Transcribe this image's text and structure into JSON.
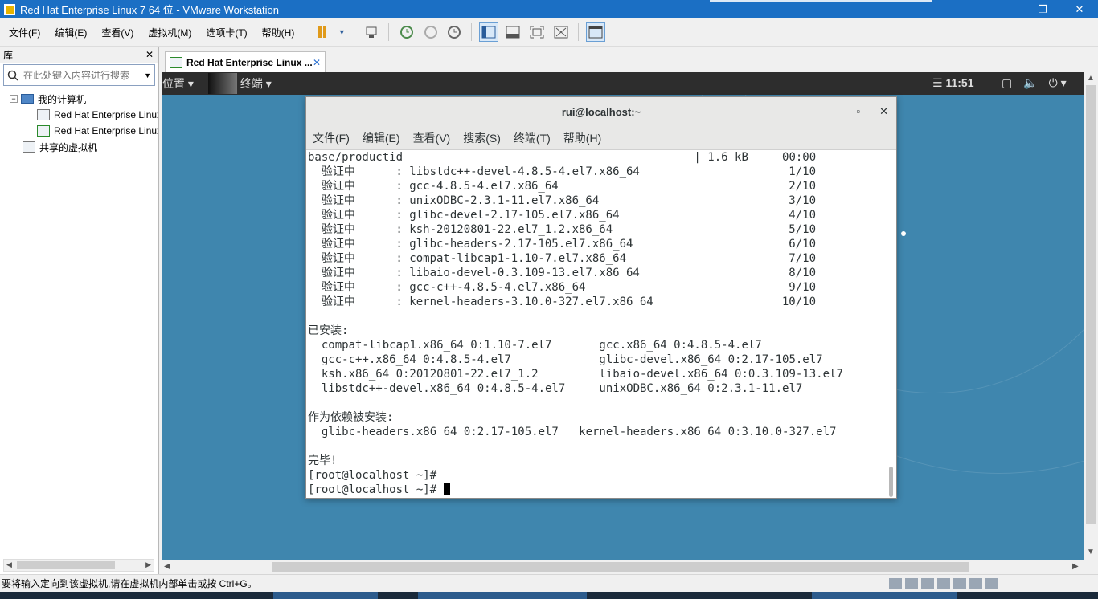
{
  "window": {
    "title": "Red Hat Enterprise Linux 7 64 位 - VMware Workstation",
    "minimize": "—",
    "restore": "❐",
    "close": "✕"
  },
  "menu": [
    "文件(F)",
    "编辑(E)",
    "查看(V)",
    "虚拟机(M)",
    "选项卡(T)",
    "帮助(H)"
  ],
  "library": {
    "header": "库",
    "close": "✕",
    "search_placeholder": "在此处键入内容进行搜索",
    "tree": {
      "my_computer": "我的计算机",
      "vm1": "Red Hat Enterprise Linux",
      "vm2": "Red Hat Enterprise Linux",
      "shared": "共享的虚拟机"
    }
  },
  "vm_tab": {
    "label": "Red Hat Enterprise Linux ...",
    "close": "✕"
  },
  "gnome": {
    "places": "位置 ▾",
    "app": "终端 ▾",
    "clock": "☰ 11:51"
  },
  "terminal": {
    "title": "rui@localhost:~",
    "menu": [
      "文件(F)",
      "编辑(E)",
      "查看(V)",
      "搜索(S)",
      "终端(T)",
      "帮助(H)"
    ],
    "lines": [
      "base/productid                                           | 1.6 kB     00:00",
      "  验证中      : libstdc++-devel-4.8.5-4.el7.x86_64                      1/10",
      "  验证中      : gcc-4.8.5-4.el7.x86_64                                  2/10",
      "  验证中      : unixODBC-2.3.1-11.el7.x86_64                            3/10",
      "  验证中      : glibc-devel-2.17-105.el7.x86_64                         4/10",
      "  验证中      : ksh-20120801-22.el7_1.2.x86_64                          5/10",
      "  验证中      : glibc-headers-2.17-105.el7.x86_64                       6/10",
      "  验证中      : compat-libcap1-1.10-7.el7.x86_64                        7/10",
      "  验证中      : libaio-devel-0.3.109-13.el7.x86_64                      8/10",
      "  验证中      : gcc-c++-4.8.5-4.el7.x86_64                              9/10",
      "  验证中      : kernel-headers-3.10.0-327.el7.x86_64                   10/10",
      "",
      "已安装:",
      "  compat-libcap1.x86_64 0:1.10-7.el7       gcc.x86_64 0:4.8.5-4.el7",
      "  gcc-c++.x86_64 0:4.8.5-4.el7             glibc-devel.x86_64 0:2.17-105.el7",
      "  ksh.x86_64 0:20120801-22.el7_1.2         libaio-devel.x86_64 0:0.3.109-13.el7",
      "  libstdc++-devel.x86_64 0:4.8.5-4.el7     unixODBC.x86_64 0:2.3.1-11.el7",
      "",
      "作为依赖被安装:",
      "  glibc-headers.x86_64 0:2.17-105.el7   kernel-headers.x86_64 0:3.10.0-327.el7",
      "",
      "完毕!",
      "[root@localhost ~]# ",
      "[root@localhost ~]# "
    ]
  },
  "statusbar": {
    "text": "要将输入定向到该虚拟机,请在虚拟机内部单击或按 Ctrl+G。"
  }
}
